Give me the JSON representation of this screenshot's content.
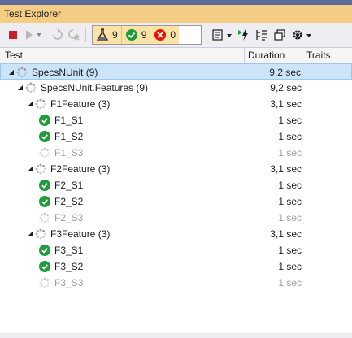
{
  "window": {
    "title": "Test Explorer"
  },
  "toolbar": {
    "groups": {
      "total_count": "9",
      "passed_count": "9",
      "failed_count": "0"
    }
  },
  "columns": {
    "test": "Test",
    "duration": "Duration",
    "traits": "Traits"
  },
  "tree": [
    {
      "label": "SpecsNUnit (9)",
      "duration": "9,2 sec",
      "level": 0,
      "state": "running",
      "expanded": true,
      "selected": true
    },
    {
      "label": "SpecsNUnit.Features (9)",
      "duration": "9,2 sec",
      "level": 1,
      "state": "running",
      "expanded": true
    },
    {
      "label": "F1Feature (3)",
      "duration": "3,1 sec",
      "level": 2,
      "state": "running",
      "expanded": true
    },
    {
      "label": "F1_S1",
      "duration": "1 sec",
      "level": 3,
      "state": "passed"
    },
    {
      "label": "F1_S2",
      "duration": "1 sec",
      "level": 3,
      "state": "passed"
    },
    {
      "label": "F1_S3",
      "duration": "1 sec",
      "level": 3,
      "state": "pending"
    },
    {
      "label": "F2Feature (3)",
      "duration": "3,1 sec",
      "level": 2,
      "state": "running",
      "expanded": true
    },
    {
      "label": "F2_S1",
      "duration": "1 sec",
      "level": 3,
      "state": "passed"
    },
    {
      "label": "F2_S2",
      "duration": "1 sec",
      "level": 3,
      "state": "passed"
    },
    {
      "label": "F2_S3",
      "duration": "1 sec",
      "level": 3,
      "state": "pending"
    },
    {
      "label": "F3Feature (3)",
      "duration": "3,1 sec",
      "level": 2,
      "state": "running",
      "expanded": true
    },
    {
      "label": "F3_S1",
      "duration": "1 sec",
      "level": 3,
      "state": "passed"
    },
    {
      "label": "F3_S2",
      "duration": "1 sec",
      "level": 3,
      "state": "passed"
    },
    {
      "label": "F3_S3",
      "duration": "1 sec",
      "level": 3,
      "state": "pending"
    }
  ],
  "colors": {
    "accent": "#f5cc84",
    "passed": "#1f9d3a",
    "failed": "#e51400",
    "stop": "#c5202a",
    "selection": "#cce4f7"
  }
}
